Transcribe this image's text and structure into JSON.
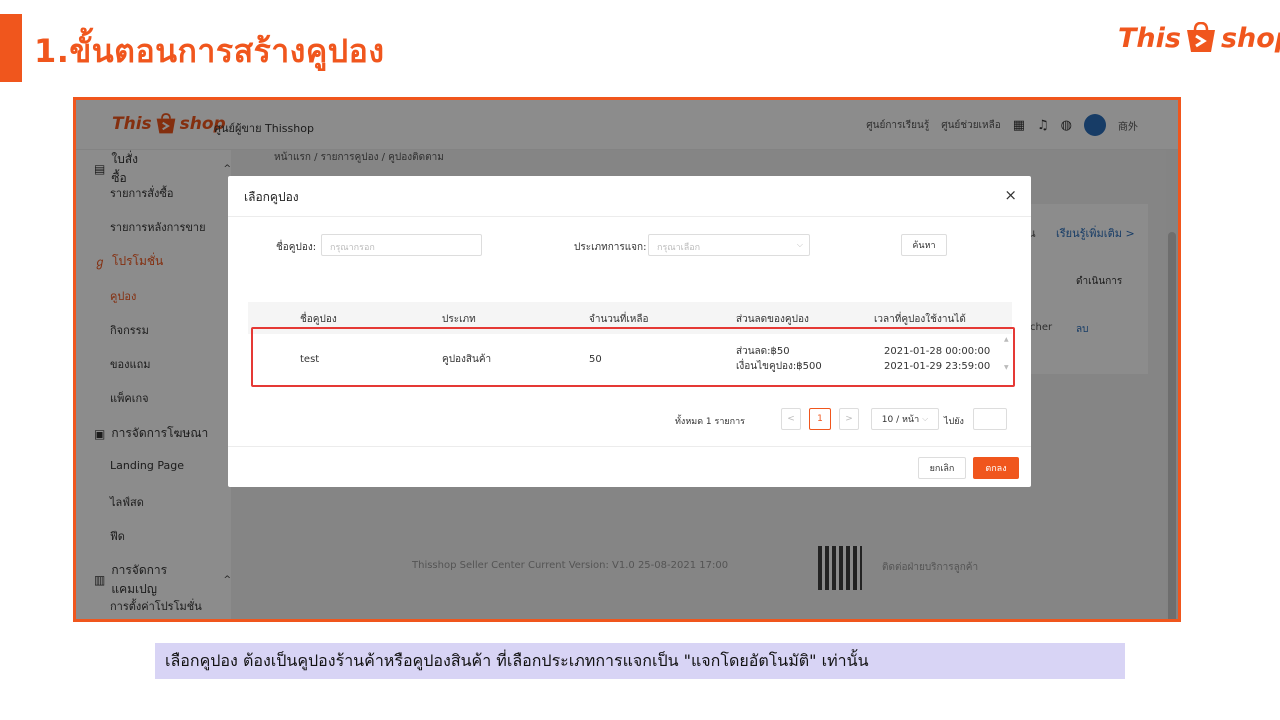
{
  "slide": {
    "title": "1.ขั้นตอนการสร้างคูปอง",
    "logo": {
      "part1": "This",
      "part2": "shop"
    },
    "caption": "เลือกคูปอง ต้องเป็นคูปองร้านค้าหรือคูปองสินค้า ที่เลือกประเภทการแจกเป็น \"แจกโดยอัตโนมัติ\" เท่านั้น",
    "accent_color": "#f0561d",
    "highlight_color": "#e53935",
    "caption_bg": "#d8d4f5"
  },
  "app": {
    "logo": {
      "part1": "This",
      "part2": "shop"
    },
    "center_title": "ศูนย์ผู้ขาย Thisshop",
    "top_links": [
      "ศูนย์การเรียนรู้",
      "ศูนย์ช่วยเหลือ"
    ],
    "top_icons": [
      "qr-icon",
      "bell-icon",
      "globe-icon"
    ],
    "user_label": "商外",
    "breadcrumb": "หน้าแรก / รายการคูปอง / คูปองติดตาม",
    "sidebar": {
      "groups": [
        {
          "label": "ใบสั่งซื้อ",
          "icon": "document-icon",
          "chevron": "^"
        },
        {
          "label": "โปรโมชั่น",
          "icon": "tag-icon"
        },
        {
          "label": "การจัดการโฆษณา",
          "icon": "square-icon"
        },
        {
          "label": "การจัดการแคมเปญ",
          "icon": "chart-icon",
          "chevron": "^"
        }
      ],
      "items": [
        "รายการสั่งซื้อ",
        "รายการหลังการขาย",
        "คูปอง",
        "กิจกรรม",
        "ของแถม",
        "แพ็คเกจ",
        "Landing Page",
        "ไลฟ์สด",
        "ฟีด",
        "การตั้งค่าโปรโมชั่นแคมเปญ"
      ]
    },
    "background": {
      "prefix": "ัน",
      "learn_more": "เรียนรู้เพิ่มเติม >",
      "col_head": "ดำเนินการ",
      "cell1": "cher",
      "cell2": "ลบ",
      "footer": "Thisshop Seller Center    Current Version: V1.0    25-08-2021 17:00",
      "footer_right": "ติดต่อฝ่ายบริการลูกค้า"
    }
  },
  "dialog": {
    "title": "เลือกคูปอง",
    "close": "×",
    "form": {
      "name_label": "ชื่อคูปอง:",
      "name_placeholder": "กรุณากรอก",
      "type_label": "ประเภทการแจก:",
      "type_placeholder": "กรุณาเลือก",
      "search_button": "ค้นหา"
    },
    "table": {
      "headers": [
        "ชื่อคูปอง",
        "ประเภท",
        "จำนวนที่เหลือ",
        "ส่วนลดของคูปอง",
        "เวลาที่คูปองใช้งานได้"
      ],
      "rows": [
        {
          "name": "test",
          "type": "คูปองสินค้า",
          "remaining": "50",
          "discount_line1": "ส่วนลด:฿50",
          "discount_line2": "เงื่อนไขคูปอง:฿500",
          "time_start": "2021-01-28 00:00:00",
          "time_end": "2021-01-29 23:59:00"
        }
      ]
    },
    "pagination": {
      "total": "ทั้งหมด 1 รายการ",
      "prev": "<",
      "current": "1",
      "next": ">",
      "page_size": "10 / หน้า",
      "goto_label": "ไปยัง"
    },
    "cancel_button": "ยกเลิก",
    "ok_button": "ตกลง"
  }
}
